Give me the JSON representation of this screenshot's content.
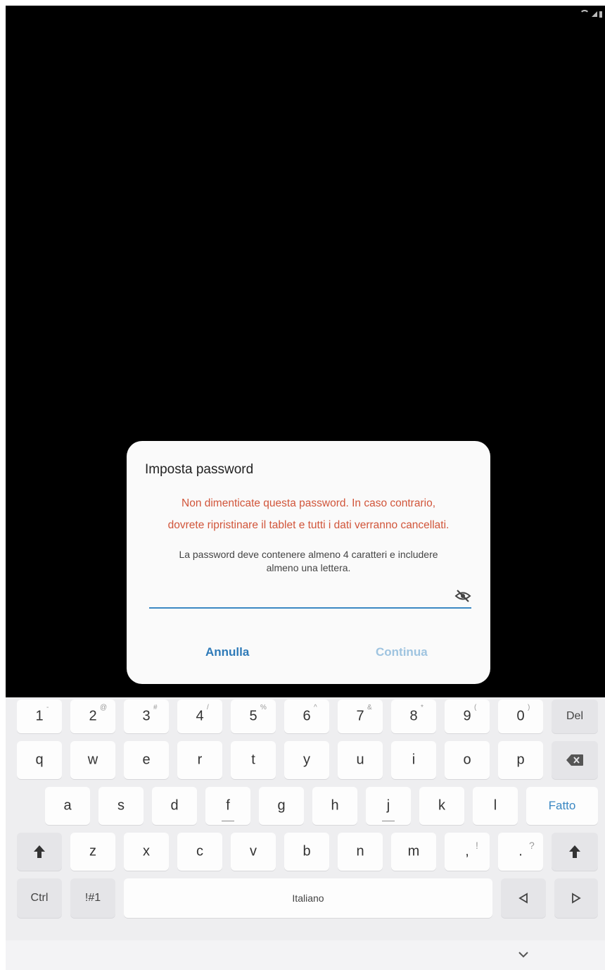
{
  "status_bar": {
    "icons": [
      "wifi-icon",
      "signal-icon",
      "battery-icon"
    ]
  },
  "dialog": {
    "title": "Imposta password",
    "warning": "Non dimenticate questa password. In caso contrario,\ndovrete ripristinare il tablet e tutti i dati verranno cancellati.",
    "hint": "La password deve contenere almeno 4 caratteri e includere\nalmeno una lettera.",
    "password_value": "",
    "visibility_icon": "eye-off-icon",
    "cancel_label": "Annulla",
    "continue_label": "Continua",
    "colors": {
      "warning": "#d1553a",
      "accent": "#2e7ab8",
      "disabled": "#9fc4e0"
    }
  },
  "keyboard": {
    "row1": [
      {
        "label": "1",
        "sup": "-"
      },
      {
        "label": "2",
        "sup": "@"
      },
      {
        "label": "3",
        "sup": "#"
      },
      {
        "label": "4",
        "sup": "/"
      },
      {
        "label": "5",
        "sup": "%"
      },
      {
        "label": "6",
        "sup": "^"
      },
      {
        "label": "7",
        "sup": "&"
      },
      {
        "label": "8",
        "sup": "*"
      },
      {
        "label": "9",
        "sup": "("
      },
      {
        "label": "0",
        "sup": ")"
      }
    ],
    "del_label": "Del",
    "row2": [
      "q",
      "w",
      "e",
      "r",
      "t",
      "y",
      "u",
      "i",
      "o",
      "p"
    ],
    "backspace_icon": "backspace-icon",
    "row3": [
      "a",
      "s",
      "d",
      "f",
      "g",
      "h",
      "j",
      "k",
      "l"
    ],
    "done_label": "Fatto",
    "row4": [
      "z",
      "x",
      "c",
      "v",
      "b",
      "n",
      "m"
    ],
    "comma_key": {
      "label": ",",
      "sup": "!"
    },
    "period_key": {
      "label": ".",
      "sup": "?"
    },
    "shift_icon": "shift-icon",
    "ctrl_label": "Ctrl",
    "symbols_label": "!#1",
    "space_label": "Italiano",
    "left_arrow_icon": "arrow-left-icon",
    "right_arrow_icon": "arrow-right-icon"
  },
  "nav_bar": {
    "hide_keyboard_icon": "chevron-down-icon"
  }
}
